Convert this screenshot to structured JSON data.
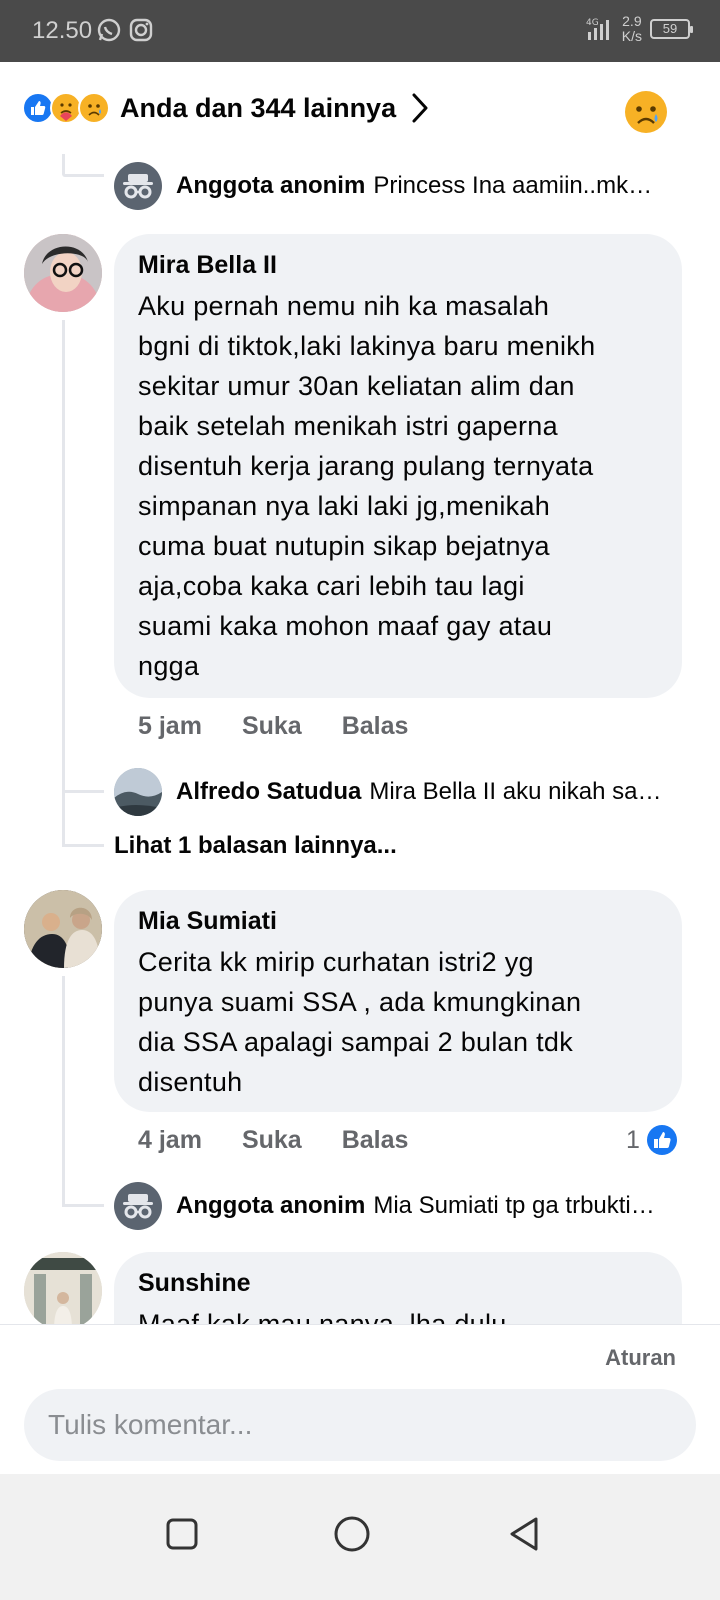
{
  "status_bar": {
    "time": "12.50",
    "network": "4G",
    "speed_value": "2.9",
    "speed_unit": "K/s",
    "battery": "59"
  },
  "reactions": {
    "summary": "Anda dan 344 lainnya",
    "icons": [
      "like-icon",
      "care-icon",
      "sad-icon"
    ]
  },
  "thread": {
    "top_reply": {
      "author": "Anggota anonim",
      "text": "Princess Ina aamiin..mk…"
    },
    "comments": [
      {
        "author": "Mira Bella II",
        "text": "Aku pernah nemu nih ka masalah\nbgni di tiktok,laki lakinya baru menikh\nsekitar umur 30an keliatan alim dan\nbaik setelah menikah istri gaperna\ndisentuh kerja jarang pulang ternyata\nsimpanan nya laki laki jg,menikah\ncuma buat nutupin sikap bejatnya\naja,coba kaka cari lebih tau lagi\nsuami kaka mohon maaf gay atau\nngga",
        "time": "5 jam",
        "like_label": "Suka",
        "reply_label": "Balas",
        "reply": {
          "author": "Alfredo Satudua",
          "text": "Mira Bella II aku nikah sa…"
        },
        "more_replies": "Lihat 1 balasan lainnya..."
      },
      {
        "author": "Mia Sumiati",
        "text": "Cerita kk mirip curhatan istri2 yg\npunya suami SSA , ada kmungkinan\ndia SSA apalagi sampai 2 bulan tdk\ndisentuh",
        "time": "4 jam",
        "like_label": "Suka",
        "reply_label": "Balas",
        "like_count": "1",
        "reply": {
          "author": "Anggota anonim",
          "text": "Mia Sumiati tp ga trbukti…"
        }
      },
      {
        "author": "Sunshine",
        "text": "Maaf kak mau nanya, lha dulu"
      }
    ]
  },
  "footer": {
    "rules_label": "Aturan",
    "comment_placeholder": "Tulis komentar..."
  },
  "colors": {
    "fb_blue": "#1877f2",
    "bubble_bg": "#f0f2f5",
    "secondary_text": "#65676b"
  }
}
